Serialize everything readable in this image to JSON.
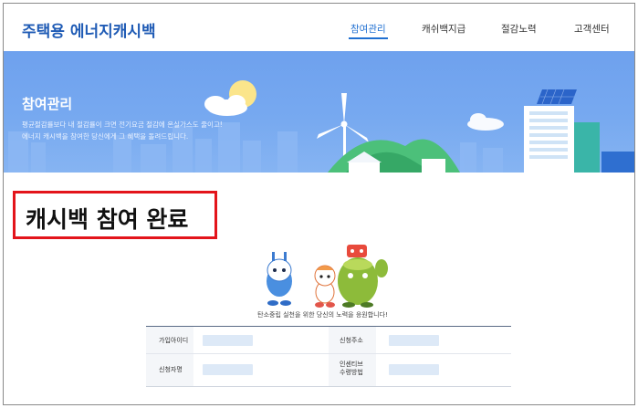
{
  "header": {
    "logo": "주택용 에너지캐시백",
    "nav": [
      {
        "label": "참여관리",
        "active": true
      },
      {
        "label": "캐쉬백지급",
        "active": false
      },
      {
        "label": "절감노력",
        "active": false
      },
      {
        "label": "고객센터",
        "active": false
      }
    ]
  },
  "banner": {
    "title": "참여관리",
    "desc_line1": "평균절감률보다 내 절감률이 크면 전기요금 절감에 온실가스도 줄이고!",
    "desc_line2": "에너지 캐시백을 참여한 당신에게 그 혜택을 돌려드립니다."
  },
  "completion": {
    "label": "캐시백 참여 완료"
  },
  "support_message": "탄소중립 실천을 위한 당신의 노력을 응원합니다!",
  "info_table": {
    "rows": [
      {
        "label_left": "가입아이디",
        "label_right": "신청주소"
      },
      {
        "label_left": "신청자명",
        "label_right_line1": "인센티브",
        "label_right_line2": "수령방법"
      }
    ]
  },
  "colors": {
    "brand": "#1f5bb5",
    "nav_active": "#1f6fd1",
    "banner": "#77a9f0",
    "highlight_border": "#e3141b",
    "field_bg": "#dde9f7"
  }
}
